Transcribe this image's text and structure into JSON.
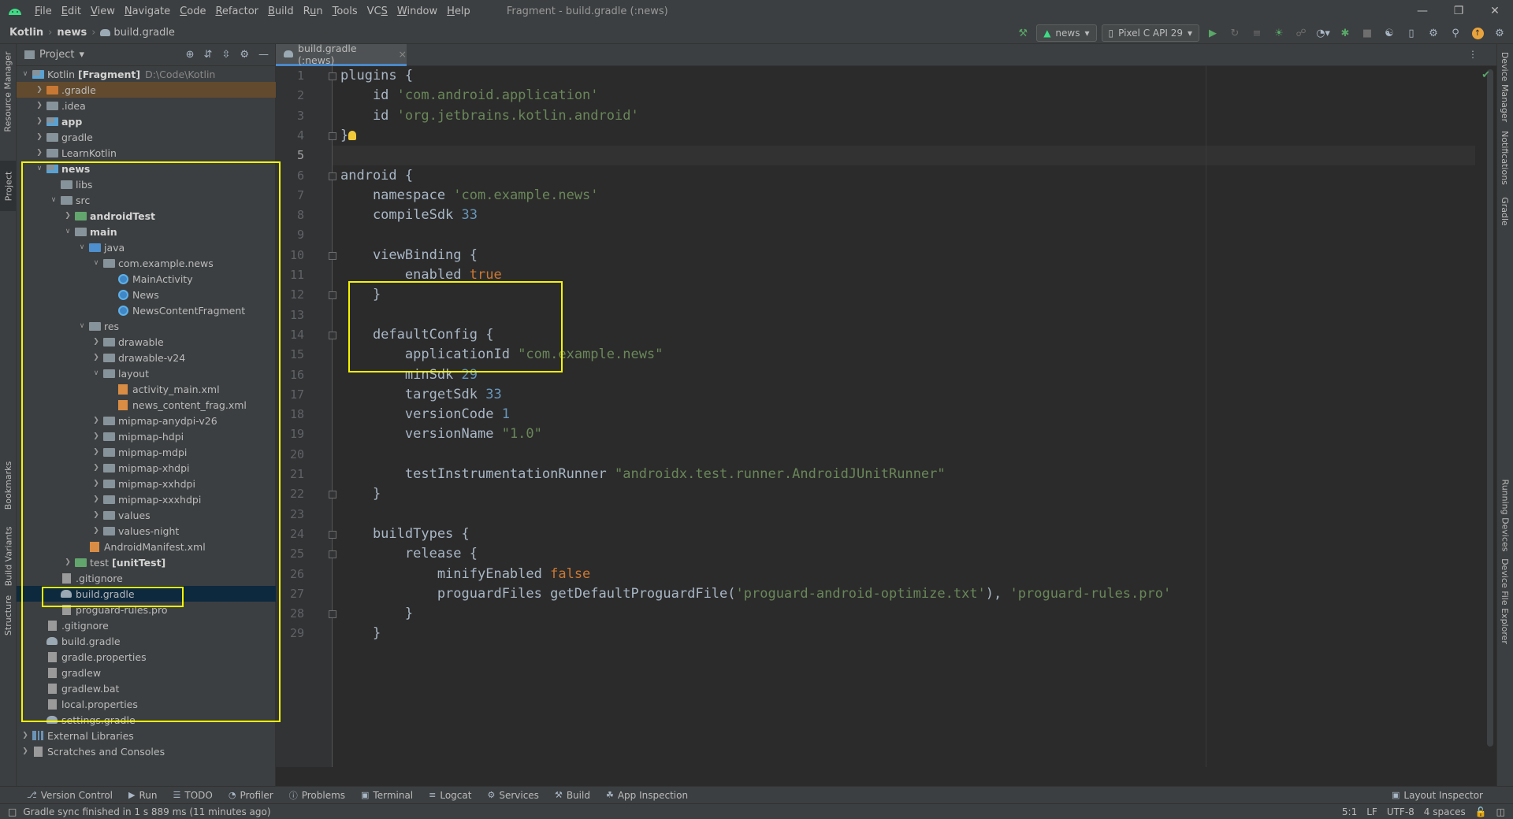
{
  "menubar": {
    "items": [
      {
        "pre": "",
        "u": "F",
        "post": "ile"
      },
      {
        "pre": "",
        "u": "E",
        "post": "dit"
      },
      {
        "pre": "",
        "u": "V",
        "post": "iew"
      },
      {
        "pre": "",
        "u": "N",
        "post": "avigate"
      },
      {
        "pre": "",
        "u": "C",
        "post": "ode"
      },
      {
        "pre": "",
        "u": "R",
        "post": "efactor"
      },
      {
        "pre": "",
        "u": "B",
        "post": "uild"
      },
      {
        "pre": "R",
        "u": "u",
        "post": "n"
      },
      {
        "pre": "",
        "u": "T",
        "post": "ools"
      },
      {
        "pre": "VC",
        "u": "S",
        "post": ""
      },
      {
        "pre": "",
        "u": "W",
        "post": "indow"
      },
      {
        "pre": "",
        "u": "H",
        "post": "elp"
      }
    ],
    "window_title": "Fragment - build.gradle (:news)"
  },
  "navbar": {
    "crumbs": [
      "Kotlin",
      "news",
      "build.gradle"
    ],
    "run_config": "news",
    "device": "Pixel C API 29"
  },
  "left_stripe": {
    "resource_manager": "Resource Manager",
    "project": "Project",
    "bookmarks": "Bookmarks",
    "build_variants": "Build Variants",
    "structure": "Structure"
  },
  "right_stripe": {
    "device_manager": "Device Manager",
    "notifications": "Notifications",
    "gradle": "Gradle",
    "running_devices": "Running Devices",
    "device_file_explorer": "Device File Explorer"
  },
  "project_panel": {
    "title": "Project",
    "tree": [
      {
        "label": "Kotlin",
        "bold_suffix": "[Fragment]",
        "path": "D:\\Code\\Kotlin",
        "depth": 0,
        "arrow": "open",
        "icon": "module-folder"
      },
      {
        "label": ".gradle",
        "depth": 1,
        "arrow": "closed",
        "icon": "orange-folder",
        "state": "highlighted"
      },
      {
        "label": ".idea",
        "depth": 1,
        "arrow": "closed",
        "icon": "folder"
      },
      {
        "label": "app",
        "depth": 1,
        "arrow": "closed",
        "icon": "module-folder",
        "bold": true
      },
      {
        "label": "gradle",
        "depth": 1,
        "arrow": "closed",
        "icon": "folder"
      },
      {
        "label": "LearnKotlin",
        "depth": 1,
        "arrow": "closed",
        "icon": "folder"
      },
      {
        "label": "news",
        "depth": 1,
        "arrow": "open",
        "icon": "module-folder",
        "bold": true
      },
      {
        "label": "libs",
        "depth": 2,
        "arrow": "",
        "icon": "folder"
      },
      {
        "label": "src",
        "depth": 2,
        "arrow": "open",
        "icon": "folder"
      },
      {
        "label": "androidTest",
        "depth": 3,
        "arrow": "closed",
        "icon": "green-folder",
        "bold": true
      },
      {
        "label": "main",
        "depth": 3,
        "arrow": "open",
        "icon": "folder",
        "bold": true
      },
      {
        "label": "java",
        "depth": 4,
        "arrow": "open",
        "icon": "blue-folder"
      },
      {
        "label": "com.example.news",
        "depth": 5,
        "arrow": "open",
        "icon": "folder"
      },
      {
        "label": "MainActivity",
        "depth": 6,
        "arrow": "",
        "icon": "class"
      },
      {
        "label": "News",
        "depth": 6,
        "arrow": "",
        "icon": "class"
      },
      {
        "label": "NewsContentFragment",
        "depth": 6,
        "arrow": "",
        "icon": "class"
      },
      {
        "label": "res",
        "depth": 4,
        "arrow": "open",
        "icon": "folder"
      },
      {
        "label": "drawable",
        "depth": 5,
        "arrow": "closed",
        "icon": "folder"
      },
      {
        "label": "drawable-v24",
        "depth": 5,
        "arrow": "closed",
        "icon": "folder"
      },
      {
        "label": "layout",
        "depth": 5,
        "arrow": "open",
        "icon": "folder"
      },
      {
        "label": "activity_main.xml",
        "depth": 6,
        "arrow": "",
        "icon": "xml"
      },
      {
        "label": "news_content_frag.xml",
        "depth": 6,
        "arrow": "",
        "icon": "xml"
      },
      {
        "label": "mipmap-anydpi-v26",
        "depth": 5,
        "arrow": "closed",
        "icon": "folder"
      },
      {
        "label": "mipmap-hdpi",
        "depth": 5,
        "arrow": "closed",
        "icon": "folder"
      },
      {
        "label": "mipmap-mdpi",
        "depth": 5,
        "arrow": "closed",
        "icon": "folder"
      },
      {
        "label": "mipmap-xhdpi",
        "depth": 5,
        "arrow": "closed",
        "icon": "folder"
      },
      {
        "label": "mipmap-xxhdpi",
        "depth": 5,
        "arrow": "closed",
        "icon": "folder"
      },
      {
        "label": "mipmap-xxxhdpi",
        "depth": 5,
        "arrow": "closed",
        "icon": "folder"
      },
      {
        "label": "values",
        "depth": 5,
        "arrow": "closed",
        "icon": "folder"
      },
      {
        "label": "values-night",
        "depth": 5,
        "arrow": "closed",
        "icon": "folder"
      },
      {
        "label": "AndroidManifest.xml",
        "depth": 4,
        "arrow": "",
        "icon": "xml"
      },
      {
        "label": "test",
        "bold_suffix": "[unitTest]",
        "depth": 3,
        "arrow": "closed",
        "icon": "green-folder"
      },
      {
        "label": ".gitignore",
        "depth": 2,
        "arrow": "",
        "icon": "file"
      },
      {
        "label": "build.gradle",
        "depth": 2,
        "arrow": "",
        "icon": "gradle",
        "state": "selected"
      },
      {
        "label": "proguard-rules.pro",
        "depth": 2,
        "arrow": "",
        "icon": "file"
      },
      {
        "label": ".gitignore",
        "depth": 1,
        "arrow": "",
        "icon": "file"
      },
      {
        "label": "build.gradle",
        "depth": 1,
        "arrow": "",
        "icon": "gradle"
      },
      {
        "label": "gradle.properties",
        "depth": 1,
        "arrow": "",
        "icon": "file"
      },
      {
        "label": "gradlew",
        "depth": 1,
        "arrow": "",
        "icon": "file"
      },
      {
        "label": "gradlew.bat",
        "depth": 1,
        "arrow": "",
        "icon": "file"
      },
      {
        "label": "local.properties",
        "depth": 1,
        "arrow": "",
        "icon": "file"
      },
      {
        "label": "settings.gradle",
        "depth": 1,
        "arrow": "",
        "icon": "gradle"
      },
      {
        "label": "External Libraries",
        "depth": 0,
        "arrow": "closed",
        "icon": "lib"
      },
      {
        "label": "Scratches and Consoles",
        "depth": 0,
        "arrow": "closed",
        "icon": "file"
      }
    ]
  },
  "editor": {
    "tab_label": "build.gradle (:news)",
    "line_numbers": [
      "1",
      "2",
      "3",
      "4",
      "5",
      "6",
      "7",
      "8",
      "9",
      "10",
      "11",
      "12",
      "13",
      "14",
      "15",
      "16",
      "17",
      "18",
      "19",
      "20",
      "21",
      "22",
      "23",
      "24",
      "25",
      "26",
      "27",
      "28",
      "29"
    ],
    "lines": [
      [
        [
          "plain",
          "plugins {"
        ]
      ],
      [
        [
          "plain",
          "    id "
        ],
        [
          "str",
          "'com.android.application'"
        ]
      ],
      [
        [
          "plain",
          "    id "
        ],
        [
          "str",
          "'org.jetbrains.kotlin.android'"
        ]
      ],
      [
        [
          "plain",
          "}"
        ]
      ],
      [],
      [
        [
          "plain",
          "android {"
        ]
      ],
      [
        [
          "plain",
          "    namespace "
        ],
        [
          "str",
          "'com.example.news'"
        ]
      ],
      [
        [
          "plain",
          "    compileSdk "
        ],
        [
          "num",
          "33"
        ]
      ],
      [],
      [
        [
          "plain",
          "    viewBinding {"
        ]
      ],
      [
        [
          "plain",
          "        enabled "
        ],
        [
          "kw",
          "true"
        ]
      ],
      [
        [
          "plain",
          "    }"
        ]
      ],
      [],
      [
        [
          "plain",
          "    defaultConfig {"
        ]
      ],
      [
        [
          "plain",
          "        applicationId "
        ],
        [
          "str",
          "\"com.example.news\""
        ]
      ],
      [
        [
          "plain",
          "        minSdk "
        ],
        [
          "num",
          "29"
        ]
      ],
      [
        [
          "plain",
          "        targetSdk "
        ],
        [
          "num",
          "33"
        ]
      ],
      [
        [
          "plain",
          "        versionCode "
        ],
        [
          "num",
          "1"
        ]
      ],
      [
        [
          "plain",
          "        versionName "
        ],
        [
          "str",
          "\"1.0\""
        ]
      ],
      [],
      [
        [
          "plain",
          "        testInstrumentationRunner "
        ],
        [
          "str",
          "\"androidx.test.runner.AndroidJUnitRunner\""
        ]
      ],
      [
        [
          "plain",
          "    }"
        ]
      ],
      [],
      [
        [
          "plain",
          "    buildTypes {"
        ]
      ],
      [
        [
          "plain",
          "        release {"
        ]
      ],
      [
        [
          "plain",
          "            minifyEnabled "
        ],
        [
          "kw",
          "false"
        ]
      ],
      [
        [
          "plain",
          "            proguardFiles getDefaultProguardFile("
        ],
        [
          "str",
          "'proguard-android-optimize.txt'"
        ],
        [
          "plain",
          "), "
        ],
        [
          "str",
          "'proguard-rules.pro'"
        ]
      ],
      [
        [
          "plain",
          "        }"
        ]
      ],
      [
        [
          "plain",
          "    }"
        ]
      ]
    ]
  },
  "bottom_tools": [
    {
      "label": "Version Control",
      "icon": "branch-icon"
    },
    {
      "label": "Run",
      "icon": "run-icon"
    },
    {
      "label": "TODO",
      "icon": "todo-icon"
    },
    {
      "label": "Profiler",
      "icon": "profiler-icon"
    },
    {
      "label": "Problems",
      "icon": "problems-icon"
    },
    {
      "label": "Terminal",
      "icon": "terminal-icon"
    },
    {
      "label": "Logcat",
      "icon": "logcat-icon"
    },
    {
      "label": "Services",
      "icon": "services-icon"
    },
    {
      "label": "Build",
      "icon": "build-icon"
    },
    {
      "label": "App Inspection",
      "icon": "inspection-icon"
    }
  ],
  "layout_inspector": "Layout Inspector",
  "status": {
    "message": "Gradle sync finished in 1 s 889 ms (11 minutes ago)",
    "caret": "5:1",
    "line_sep": "LF",
    "encoding": "UTF-8",
    "indent": "4 spaces"
  },
  "colors": {
    "accent": "#4a88c7",
    "highlight_box": "#f5f500",
    "keyword": "#cc7832",
    "string": "#6a8759",
    "number": "#6897bb"
  }
}
